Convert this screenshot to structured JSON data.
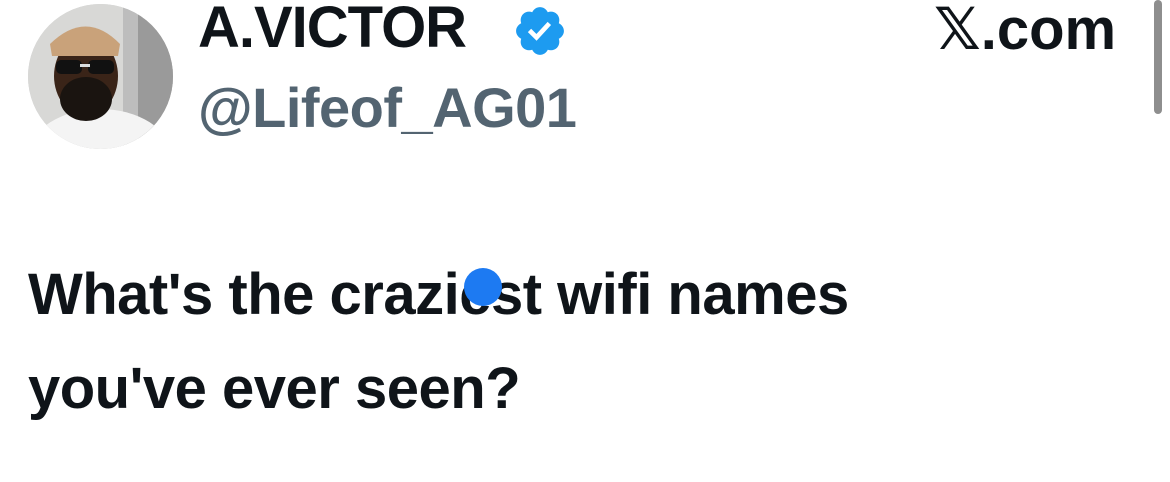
{
  "author": {
    "display_name": "A.VICTOR",
    "handle": "@Lifeof_AG01",
    "verified_icon": "verified-badge-icon",
    "avatar_icon": "avatar"
  },
  "brand": {
    "text": "𝕏.com"
  },
  "post": {
    "line1": "What's the craziest wifi names",
    "line2": "you've ever seen?"
  },
  "colors": {
    "text": "#0f1419",
    "handle": "#536471",
    "verified": "#1d9bf0",
    "cursor_dot": "#1d7af2"
  }
}
